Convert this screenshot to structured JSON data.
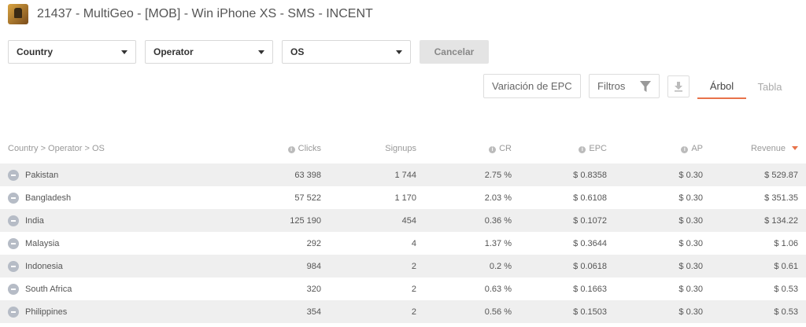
{
  "header": {
    "title": "21437 - MultiGeo - [MOB] - Win iPhone XS - SMS - INCENT",
    "logo_icon": "trophy-app-icon"
  },
  "filters": {
    "selects": [
      {
        "label": "Country"
      },
      {
        "label": "Operator"
      },
      {
        "label": "OS"
      }
    ],
    "cancel_label": "Cancelar"
  },
  "toolbar": {
    "epc_variation_label": "Variación de EPC",
    "filters_label": "Filtros",
    "filter_icon": "funnel-icon",
    "download_icon": "download-icon",
    "tabs": [
      {
        "label": "Árbol",
        "active": true
      },
      {
        "label": "Tabla",
        "active": false
      }
    ]
  },
  "colors": {
    "accent": "#e8734a",
    "row_stripe": "#efefef"
  },
  "table": {
    "columns": [
      "Country > Operator > OS",
      "Clicks",
      "Signups",
      "CR",
      "EPC",
      "AP",
      "Revenue"
    ],
    "sort_column": "Revenue",
    "rows": [
      {
        "country": "Pakistan",
        "clicks": "63 398",
        "signups": "1 744",
        "cr": "2.75 %",
        "epc": "$ 0.8358",
        "ap": "$ 0.30",
        "revenue": "$ 529.87"
      },
      {
        "country": "Bangladesh",
        "clicks": "57 522",
        "signups": "1 170",
        "cr": "2.03 %",
        "epc": "$ 0.6108",
        "ap": "$ 0.30",
        "revenue": "$ 351.35"
      },
      {
        "country": "India",
        "clicks": "125 190",
        "signups": "454",
        "cr": "0.36 %",
        "epc": "$ 0.1072",
        "ap": "$ 0.30",
        "revenue": "$ 134.22"
      },
      {
        "country": "Malaysia",
        "clicks": "292",
        "signups": "4",
        "cr": "1.37 %",
        "epc": "$ 0.3644",
        "ap": "$ 0.30",
        "revenue": "$ 1.06"
      },
      {
        "country": "Indonesia",
        "clicks": "984",
        "signups": "2",
        "cr": "0.2 %",
        "epc": "$ 0.0618",
        "ap": "$ 0.30",
        "revenue": "$ 0.61"
      },
      {
        "country": "South Africa",
        "clicks": "320",
        "signups": "2",
        "cr": "0.63 %",
        "epc": "$ 0.1663",
        "ap": "$ 0.30",
        "revenue": "$ 0.53"
      },
      {
        "country": "Philippines",
        "clicks": "354",
        "signups": "2",
        "cr": "0.56 %",
        "epc": "$ 0.1503",
        "ap": "$ 0.30",
        "revenue": "$ 0.53"
      }
    ]
  }
}
